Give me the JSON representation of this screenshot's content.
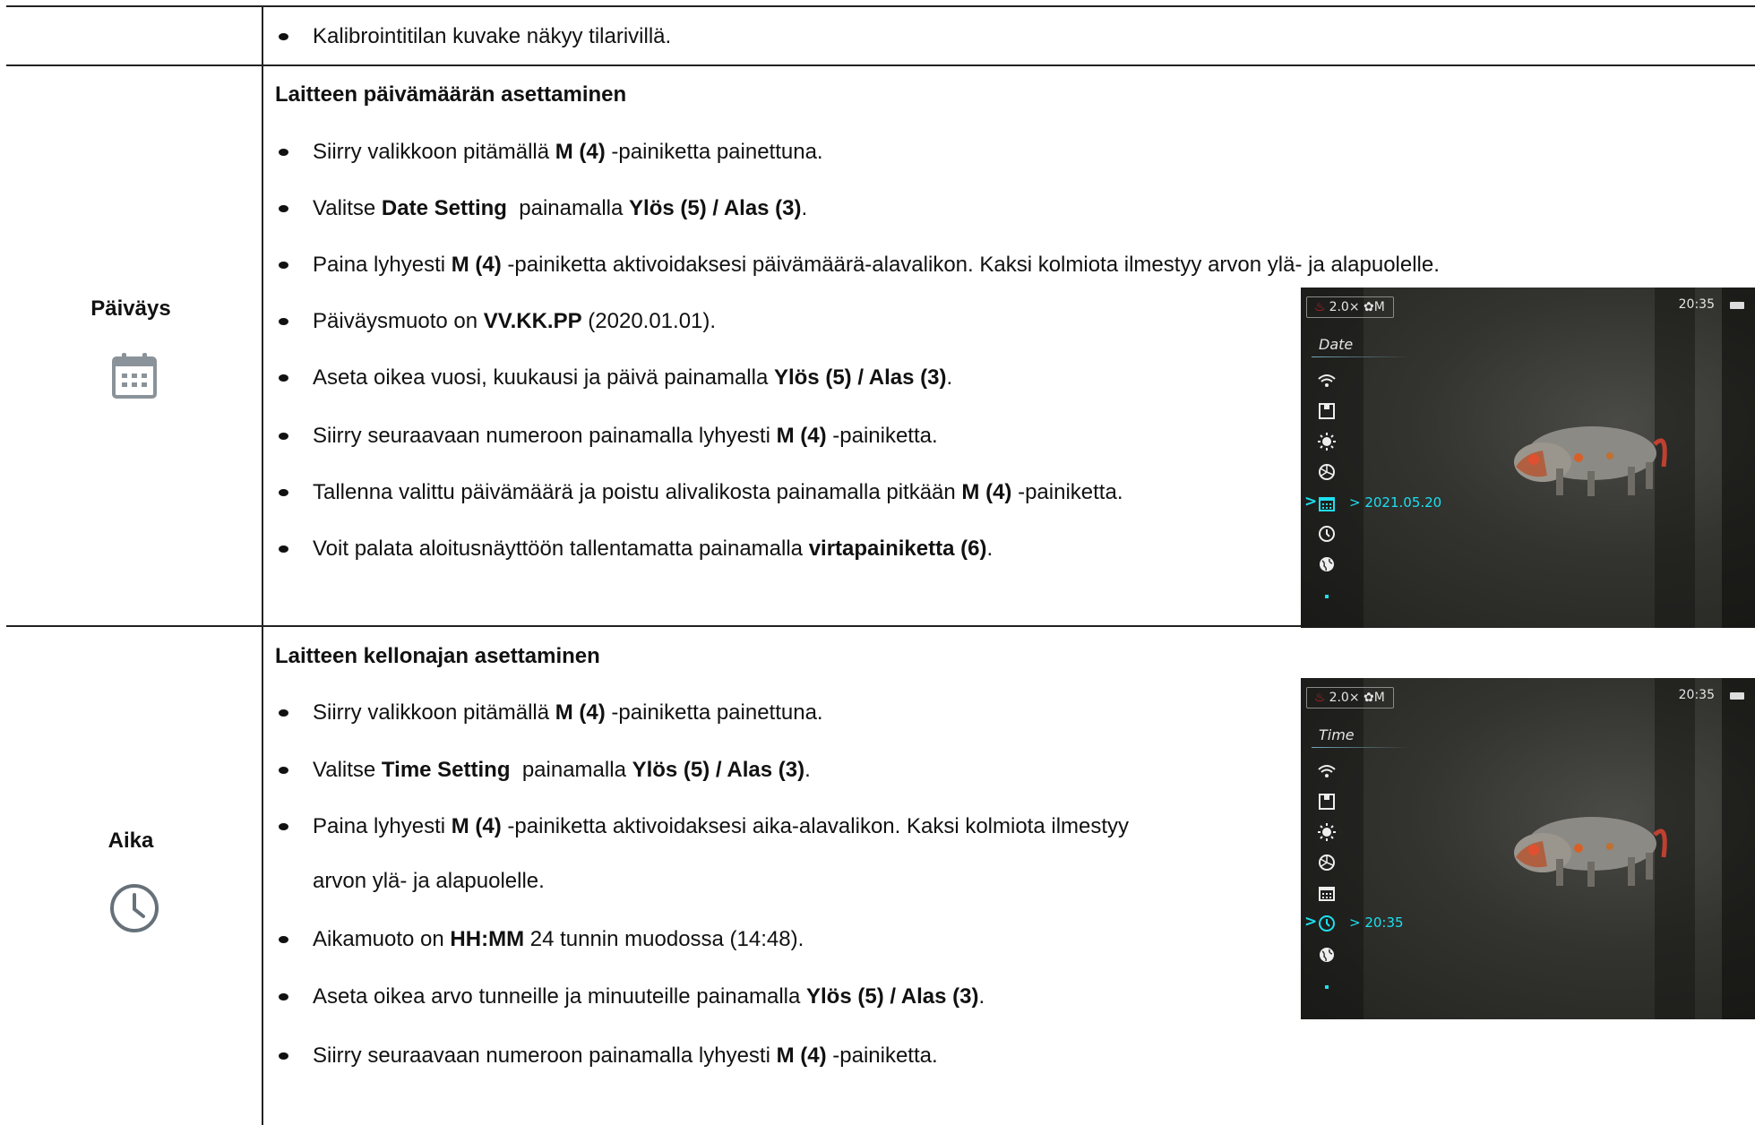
{
  "top_row": {
    "items": [
      "Kalibrointitilan kuvake näkyy tilarivillä."
    ]
  },
  "date_section": {
    "label": "Päiväys",
    "icon": "calendar-icon",
    "heading": "Laitteen päivämäärän asettaminen",
    "items": [
      {
        "pre": "Siirry valikkoon pitämällä ",
        "b1": "M (4)",
        "post": " -painiketta painettuna."
      },
      {
        "pre": "Valitse ",
        "b1": "Date Setting",
        "mid": "  painamalla ",
        "b2": "Ylös (5) / Alas (3)",
        "post": "."
      },
      {
        "pre": "Paina lyhyesti ",
        "b1": "M (4)",
        "post": " -painiketta aktivoidaksesi päivämäärä-alavalikon. Kaksi kolmiota ilmestyy arvon ylä- ja alapuolelle."
      },
      {
        "pre": "Päiväysmuoto on ",
        "b1": "VV.KK.PP",
        "post": " (2020.01.01)."
      },
      {
        "pre": "Aseta oikea vuosi, kuukausi ja päivä painamalla ",
        "b1": "Ylös (5) / Alas (3)",
        "post": "."
      },
      {
        "pre": "Siirry seuraavaan numeroon painamalla lyhyesti ",
        "b1": "M (4)",
        "post": " -painiketta."
      },
      {
        "pre": "Tallenna valittu päivämäärä ja poistu alivalikosta painamalla pitkään ",
        "b1": "M (4)",
        "post": " -painiketta."
      },
      {
        "pre": "Voit palata aloitusnäyttöön tallentamatta painamalla ",
        "b1": "virtapainiketta (6)",
        "post": "."
      }
    ],
    "screen": {
      "zoom": "2.0×",
      "mode": "M",
      "time": "20:35",
      "menu_title": "Date",
      "selected_value": "2021.05.20"
    }
  },
  "time_section": {
    "label": "Aika",
    "icon": "clock-icon",
    "heading": "Laitteen kellonajan asettaminen",
    "items": [
      {
        "pre": "Siirry valikkoon pitämällä ",
        "b1": "M (4)",
        "post": " -painiketta painettuna."
      },
      {
        "pre": "Valitse ",
        "b1": "Time Setting",
        "mid": "  painamalla ",
        "b2": "Ylös (5) / Alas (3)",
        "post": "."
      },
      {
        "pre": "Paina lyhyesti ",
        "b1": "M (4)",
        "post": " -painiketta aktivoidaksesi aika-alavalikon. Kaksi kolmiota ilmestyy"
      },
      {
        "pre": "arvon ylä- ja alapuolelle."
      },
      {
        "pre": "Aikamuoto on ",
        "b1": "HH:MM",
        "post": " 24 tunnin muodossa (14:48)."
      },
      {
        "pre": "Aseta oikea arvo tunneille ja minuuteille painamalla ",
        "b1": "Ylös (5) / Alas (3)",
        "post": "."
      },
      {
        "pre": "Siirry seuraavaan numeroon painamalla lyhyesti ",
        "b1": "M (4)",
        "post": " -painiketta."
      }
    ],
    "screen": {
      "zoom": "2.0×",
      "mode": "M",
      "time": "20:35",
      "menu_title": "Time",
      "selected_value": "20:35"
    }
  },
  "icons": {
    "wifi": "wifi-icon",
    "picture": "picture-mode-icon",
    "brightness": "brightness-icon",
    "palette": "palette-icon",
    "calendar": "calendar-icon",
    "clock": "clock-icon",
    "globe": "language-icon"
  },
  "colors": {
    "accent": "#1ee0f0",
    "line": "#222222"
  }
}
